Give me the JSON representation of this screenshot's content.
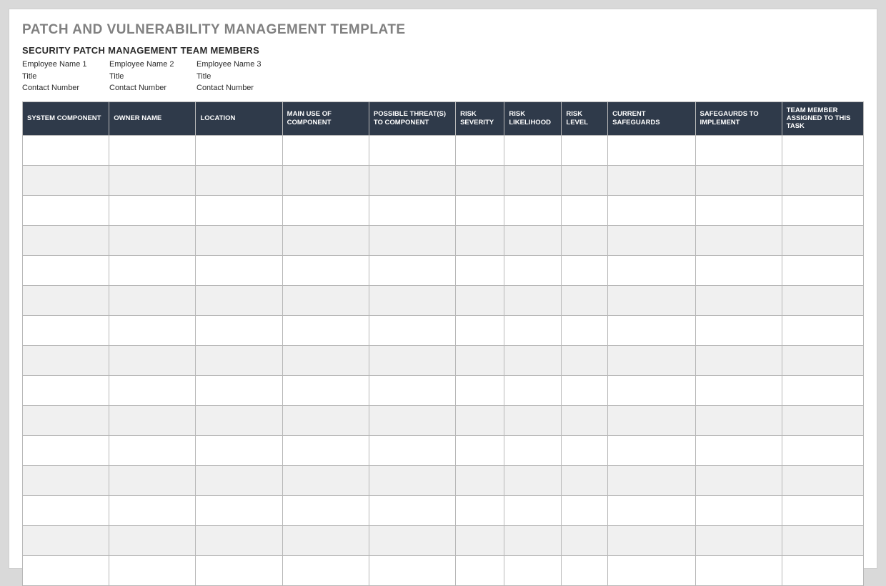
{
  "title": "PATCH AND VULNERABILITY MANAGEMENT TEMPLATE",
  "subtitle": "SECURITY PATCH MANAGEMENT TEAM MEMBERS",
  "team": [
    {
      "name": "Employee Name 1",
      "title": "Title",
      "contact": "Contact Number"
    },
    {
      "name": "Employee Name 2",
      "title": "Title",
      "contact": "Contact Number"
    },
    {
      "name": "Employee Name 3",
      "title": "Title",
      "contact": "Contact Number"
    }
  ],
  "columns": {
    "system_component": "SYSTEM COMPONENT",
    "owner_name": "OWNER NAME",
    "location": "LOCATION",
    "main_use": "MAIN USE OF COMPONENT",
    "possible_threats": "POSSIBLE THREAT(S) TO COMPONENT",
    "risk_severity": "RISK SEVERITY",
    "risk_likelihood": "RISK LIKELIHOOD",
    "risk_level": "RISK LEVEL",
    "current_safeguards": "CURRENT SAFEGUARDS",
    "safeguards_to_implement": "SAFEGAURDS TO IMPLEMENT",
    "assigned_member": "TEAM MEMBER ASSIGNED TO THIS TASK"
  },
  "row_count": 15
}
